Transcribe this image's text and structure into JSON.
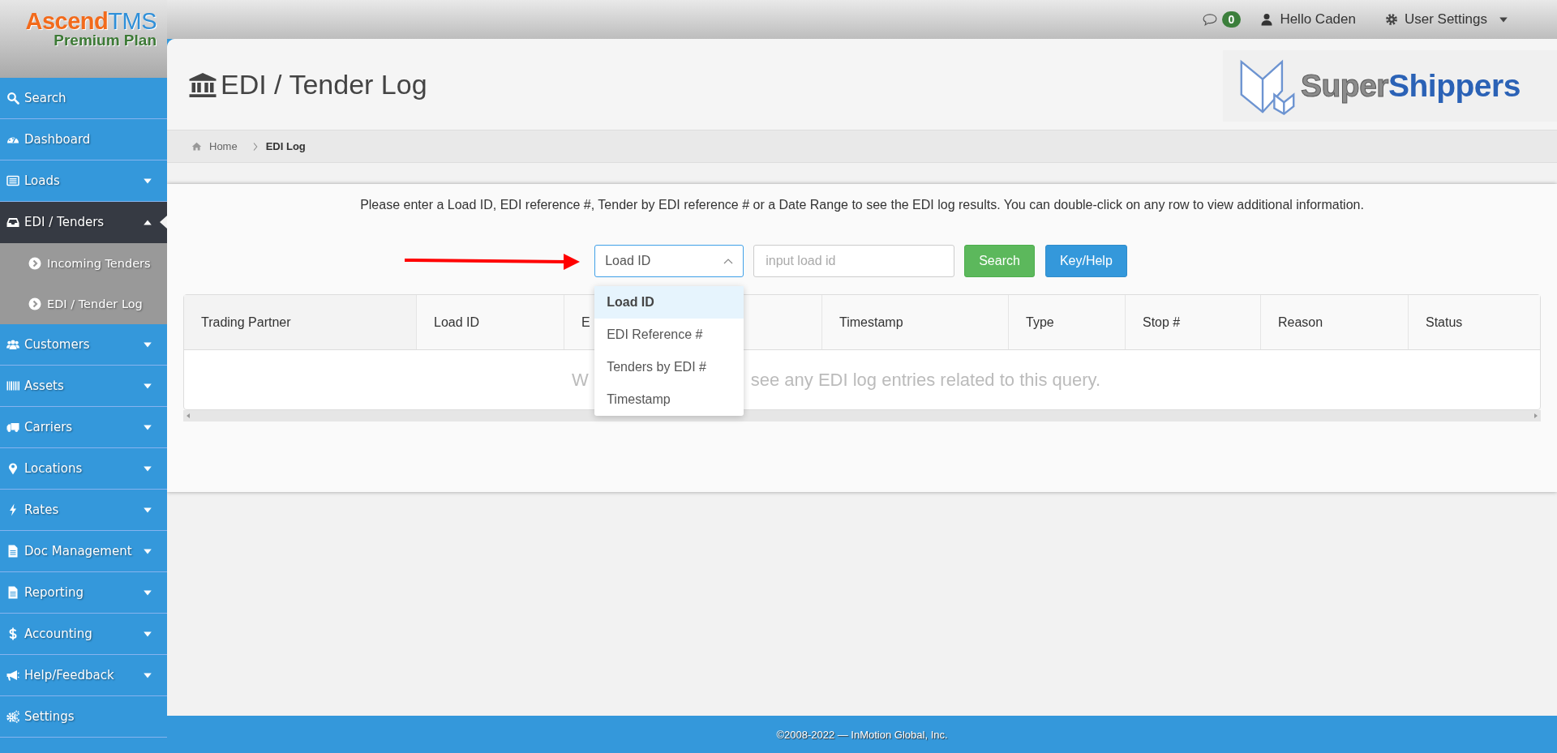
{
  "brand": {
    "name_start": "Ascend",
    "name_end": "TMS",
    "plan": "Premium Plan"
  },
  "top_bar": {
    "message_count": "0",
    "greeting": "Hello Caden",
    "settings_label": "User Settings"
  },
  "sidebar": {
    "items": [
      {
        "label": "Search",
        "kind": "link",
        "selected": false
      },
      {
        "label": "Dashboard",
        "kind": "link",
        "selected": false
      },
      {
        "label": "Loads",
        "kind": "menu",
        "expanded": false,
        "selected": false
      },
      {
        "label": "EDI / Tenders",
        "kind": "menu",
        "expanded": true,
        "selected": true,
        "children": [
          {
            "label": "Incoming Tenders",
            "selected": false
          },
          {
            "label": "EDI / Tender Log",
            "selected": false
          }
        ]
      },
      {
        "label": "Customers",
        "kind": "menu",
        "expanded": false,
        "selected": false
      },
      {
        "label": "Assets",
        "kind": "menu",
        "expanded": false,
        "selected": false
      },
      {
        "label": "Carriers",
        "kind": "menu",
        "expanded": false,
        "selected": false
      },
      {
        "label": "Locations",
        "kind": "menu",
        "expanded": false,
        "selected": false
      },
      {
        "label": "Rates",
        "kind": "menu",
        "expanded": false,
        "selected": false
      },
      {
        "label": "Doc Management",
        "kind": "menu",
        "expanded": false,
        "selected": false
      },
      {
        "label": "Reporting",
        "kind": "menu",
        "expanded": false,
        "selected": false
      },
      {
        "label": "Accounting",
        "kind": "menu",
        "expanded": false,
        "selected": false
      },
      {
        "label": "Help/Feedback",
        "kind": "menu",
        "expanded": false,
        "selected": false
      },
      {
        "label": "Settings",
        "kind": "link",
        "selected": false
      }
    ]
  },
  "page": {
    "title": "EDI / Tender Log",
    "partner_logo": {
      "text_start": "Super",
      "text_end": "Shippers"
    },
    "breadcrumb": [
      {
        "label": "Home",
        "current": false
      },
      {
        "label": "EDI Log",
        "current": true
      }
    ]
  },
  "search_panel": {
    "instructions": "Please enter a Load ID, EDI reference #, Tender by EDI reference # or a Date Range to see the EDI log results. You can double-click on any row to view additional information.",
    "select": {
      "value": "Load ID",
      "open": true,
      "options": [
        {
          "label": "Load ID",
          "selected": true
        },
        {
          "label": "EDI Reference #",
          "selected": false
        },
        {
          "label": "Tenders by EDI #",
          "selected": false
        },
        {
          "label": "Timestamp",
          "selected": false
        }
      ]
    },
    "input": {
      "placeholder": "input load id"
    },
    "buttons": [
      {
        "label": "Search",
        "kind": "success"
      },
      {
        "label": "Key/Help",
        "kind": "primary"
      }
    ]
  },
  "table": {
    "columns": [
      "Trading Partner",
      "Load ID",
      "E",
      "Timestamp",
      "Type",
      "Stop #",
      "Reason",
      "Status"
    ],
    "empty_message": {
      "start": "W",
      "end": "see any EDI log entries related to this query."
    }
  },
  "footer": "©2008-2022 — InMotion Global, Inc."
}
